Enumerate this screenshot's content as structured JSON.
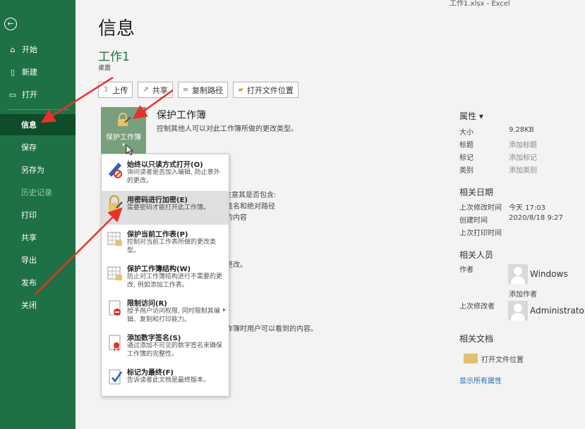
{
  "titlebar": "工作1.xlsx  -  Excel",
  "sidebar": {
    "back_icon": "back-arrow-icon",
    "items": [
      {
        "label": "开始",
        "icon": "home-icon"
      },
      {
        "label": "新建",
        "icon": "new-doc-icon"
      },
      {
        "label": "打开",
        "icon": "folder-open-icon"
      },
      {
        "label": "信息"
      },
      {
        "label": "保存"
      },
      {
        "label": "另存为"
      },
      {
        "label": "历史记录"
      },
      {
        "label": "打印"
      },
      {
        "label": "共享"
      },
      {
        "label": "导出"
      },
      {
        "label": "发布"
      },
      {
        "label": "关闭"
      }
    ]
  },
  "main": {
    "page_title": "信息",
    "doc_name": "工作1",
    "doc_location": "桌面",
    "buttons": [
      {
        "label": "上传",
        "icon": "upload-icon"
      },
      {
        "label": "共享",
        "icon": "share-icon"
      },
      {
        "label": "复制路径",
        "icon": "link-icon"
      },
      {
        "label": "打开文件位置",
        "icon": "folder-icon"
      }
    ],
    "protect": {
      "tile_label": "保护工作簿",
      "caret": "▾",
      "title": "保护工作簿",
      "desc": "控制其他人可以对此工作簿所做的更改类型。"
    },
    "background_texts": [
      "注意其是否包含:",
      "姓名和绝对路径",
      "的内容",
      "更改。",
      "作簿时用户可以看到的内容。"
    ]
  },
  "dropdown": {
    "items": [
      {
        "title": "始终以只读方式打开(O)",
        "desc": "询问读者是否加入编辑, 防止意外的更改。",
        "icon": "readonly-pencil-icon"
      },
      {
        "title": "用密码进行加密(E)",
        "desc": "需要密码才能打开此工作簿。",
        "icon": "lock-key-icon"
      },
      {
        "title": "保护当前工作表(P)",
        "desc": "控制对当前工作表所做的更改类型。",
        "icon": "protect-sheet-icon"
      },
      {
        "title": "保护工作簿结构(W)",
        "desc": "防止对工作簿结构进行不需要的更改, 例如添加工作表。",
        "icon": "protect-structure-icon"
      },
      {
        "title": "限制访问(R)",
        "desc": "授予用户访问权限, 同时限制其编辑、复制和打印能力。",
        "icon": "restrict-access-icon",
        "submenu": "▸"
      },
      {
        "title": "添加数字签名(S)",
        "desc": "通过添加不可见的数字签名来确保工作簿的完整性。",
        "icon": "digital-signature-icon"
      },
      {
        "title": "标记为最终(F)",
        "desc": "告诉读者此文档是最终版本。",
        "icon": "mark-final-icon"
      }
    ]
  },
  "properties": {
    "header": "属性 ▾",
    "rows": [
      {
        "label": "大小",
        "value": "9.28KB"
      },
      {
        "label": "标题",
        "value": "添加标题"
      },
      {
        "label": "标记",
        "value": "添加标记"
      },
      {
        "label": "类别",
        "value": "添加类别"
      }
    ],
    "dates_header": "相关日期",
    "dates": [
      {
        "label": "上次修改时间",
        "value": "今天 17:03"
      },
      {
        "label": "创建时间",
        "value": "2020/8/18 9:27"
      },
      {
        "label": "上次打印时间",
        "value": ""
      }
    ],
    "people_header": "相关人员",
    "author_label": "作者",
    "author_name": "Windows",
    "add_author": "添加作者",
    "last_modified_label": "上次修改者",
    "last_modified_name": "Administrator",
    "docs_header": "相关文档",
    "open_location": "打开文件位置",
    "show_all": "显示所有属性"
  },
  "colors": {
    "sidebar": "#1e7145",
    "sidebar_active": "#0f4d2a",
    "accent": "#1e7145",
    "annotation_arrow": "#e8312a"
  }
}
